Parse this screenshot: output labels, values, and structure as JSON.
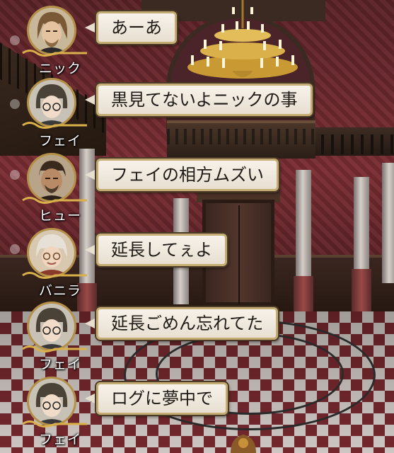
{
  "chat_log": [
    {
      "speaker": "ニック",
      "message": "あーあ",
      "portrait": "nick-portrait-icon"
    },
    {
      "speaker": "フェイ",
      "message": "黒見てないよニックの事",
      "portrait": "fei-portrait-icon"
    },
    {
      "speaker": "ヒュー",
      "message": "フェイの相方ムズい",
      "portrait": "hugh-portrait-icon"
    },
    {
      "speaker": "バニラ",
      "message": "延長してぇよ",
      "portrait": "vanilla-portrait-icon"
    },
    {
      "speaker": "フェイ",
      "message": "延長ごめん忘れてた",
      "portrait": "fei-portrait-icon"
    },
    {
      "speaker": "フェイ",
      "message": "ログに夢中で",
      "portrait": "fei-portrait-icon"
    }
  ],
  "colors": {
    "bubble_bg": "#f3eee5",
    "bubble_border": "#c4ac74",
    "name_text": "#ffffff",
    "message_text": "#1e1a16",
    "wall": "#7a2d33",
    "floor_red": "#7a2a30",
    "gold": "#d9b04a"
  }
}
